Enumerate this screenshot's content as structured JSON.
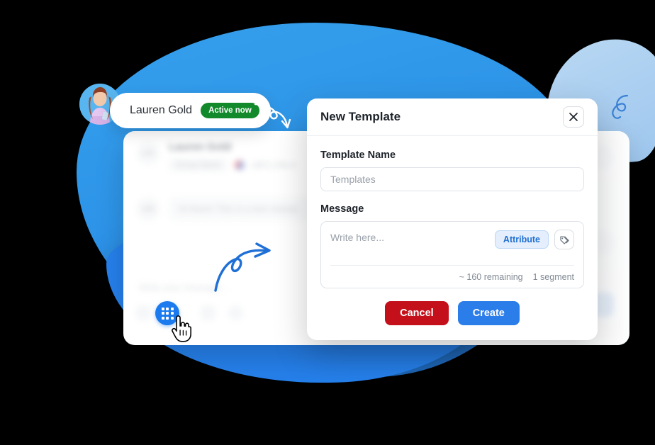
{
  "decor": {
    "blob_main_color": "#2e95e8",
    "blob_lower_color": "#2680eb",
    "blob_light_color": "#aed1f1",
    "arrow_white_name": "white-curved-arrow",
    "arrow_blue_name": "blue-curved-arrow",
    "squiggle_name": "blue-squiggle-doodle"
  },
  "contact_card": {
    "name": "Lauren Gold",
    "status_badge": "Active now",
    "badge_color": "#128a2b",
    "avatar_alt": "Lauren Gold avatar"
  },
  "background_app": {
    "contact": {
      "initials": "LG",
      "name": "Lauren Gold",
      "group_tag": "Group Name",
      "phone": "(357) 234-2"
    },
    "message": {
      "initials": "LG",
      "text": "Hi there! This is a test messa"
    },
    "composer_placeholder": "Write your message...",
    "keypad_button_name": "keypad-grid-button"
  },
  "modal": {
    "title": "New Template",
    "close_label": "×",
    "template_name": {
      "label": "Template Name",
      "placeholder": "Templates",
      "value": ""
    },
    "message": {
      "label": "Message",
      "placeholder": "Write here...",
      "value": "",
      "attribute_button": "Attribute",
      "remaining": "~ 160 remaining",
      "segments": "1 segment"
    },
    "buttons": {
      "cancel": "Cancel",
      "cancel_color": "#c3101b",
      "create": "Create",
      "create_color": "#2b7de9"
    }
  }
}
